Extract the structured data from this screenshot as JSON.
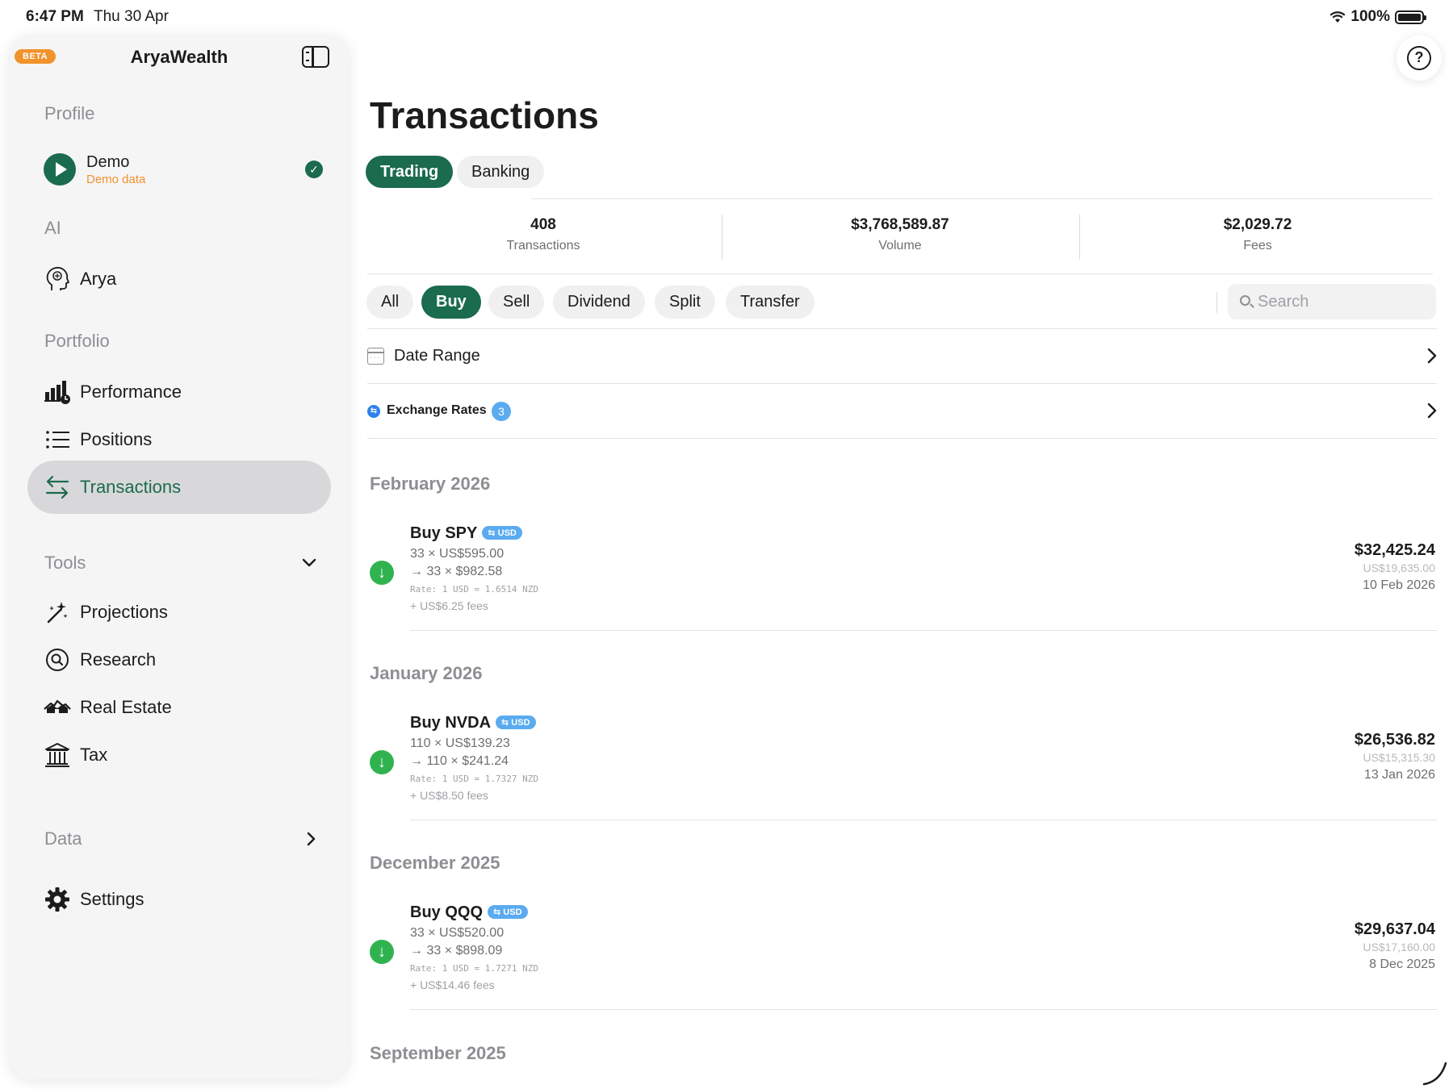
{
  "status_bar": {
    "time": "6:47 PM",
    "date": "Thu 30 Apr",
    "battery": "100%"
  },
  "sidebar": {
    "beta": "BETA",
    "app_title": "AryaWealth",
    "sections": {
      "profile": "Profile",
      "ai": "AI",
      "portfolio": "Portfolio",
      "tools": "Tools",
      "data": "Data"
    },
    "profile": {
      "name": "Demo",
      "subtitle": "Demo data"
    },
    "items": {
      "arya": "Arya",
      "performance": "Performance",
      "positions": "Positions",
      "transactions": "Transactions",
      "projections": "Projections",
      "research": "Research",
      "real_estate": "Real Estate",
      "tax": "Tax",
      "settings": "Settings"
    }
  },
  "main": {
    "title": "Transactions",
    "tabs": [
      "Trading",
      "Banking"
    ],
    "stats": [
      {
        "value": "408",
        "label": "Transactions"
      },
      {
        "value": "$3,768,589.87",
        "label": "Volume"
      },
      {
        "value": "$2,029.72",
        "label": "Fees"
      }
    ],
    "filters": [
      "All",
      "Buy",
      "Sell",
      "Dividend",
      "Split",
      "Transfer"
    ],
    "search_placeholder": "Search",
    "date_range": "Date Range",
    "exchange_rates": {
      "label": "Exchange Rates",
      "count": "3"
    },
    "groups": [
      {
        "month": "February 2026",
        "txn": {
          "title": "Buy SPY",
          "currency": "⇆ USD",
          "line1": "33 × US$595.00",
          "line2": "→ 33 × $982.58",
          "rate": "Rate: 1 USD = 1.6514 NZD",
          "fees": "+ US$6.25 fees",
          "amount": "$32,425.24",
          "original": "US$19,635.00",
          "date": "10 Feb 2026"
        }
      },
      {
        "month": "January 2026",
        "txn": {
          "title": "Buy NVDA",
          "currency": "⇆ USD",
          "line1": "110 × US$139.23",
          "line2": "→ 110 × $241.24",
          "rate": "Rate: 1 USD = 1.7327 NZD",
          "fees": "+ US$8.50 fees",
          "amount": "$26,536.82",
          "original": "US$15,315.30",
          "date": "13 Jan 2026"
        }
      },
      {
        "month": "December 2025",
        "txn": {
          "title": "Buy QQQ",
          "currency": "⇆ USD",
          "line1": "33 × US$520.00",
          "line2": "→ 33 × $898.09",
          "rate": "Rate: 1 USD = 1.7271 NZD",
          "fees": "+ US$14.46 fees",
          "amount": "$29,637.04",
          "original": "US$17,160.00",
          "date": "8 Dec 2025"
        }
      },
      {
        "month": "September 2025"
      }
    ]
  }
}
